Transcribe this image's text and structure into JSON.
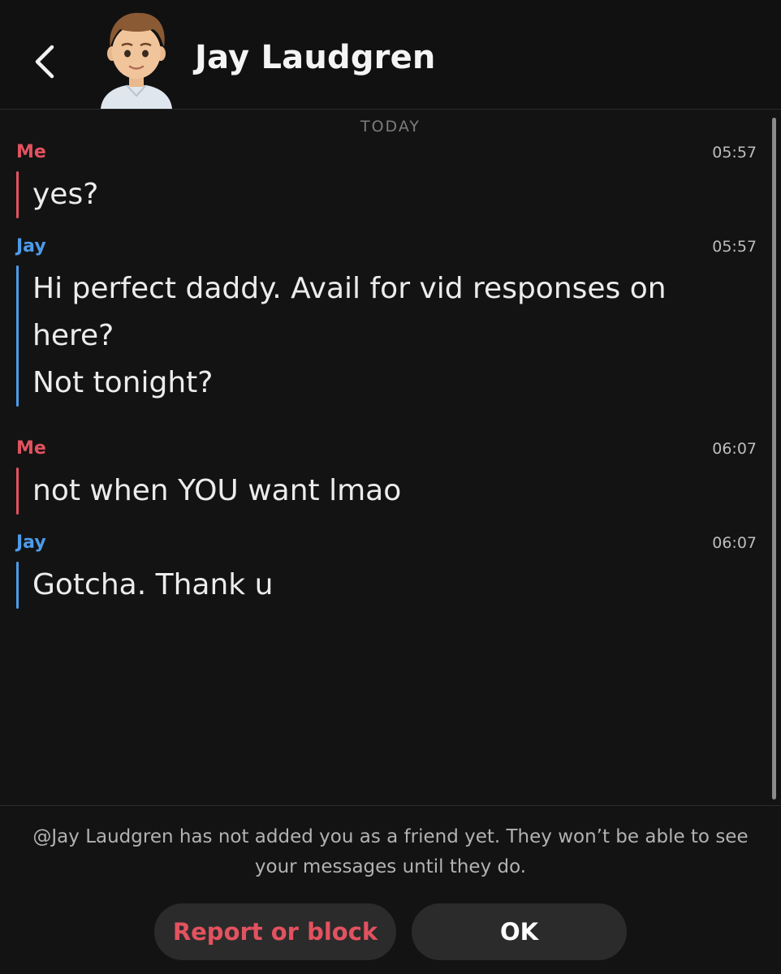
{
  "header": {
    "contact_name": "Jay Laudgren",
    "back_icon": "chevron-left-icon",
    "avatar_icon": "bitmoji-avatar"
  },
  "chat": {
    "day_separator": "TODAY",
    "messages": [
      {
        "sender": "Me",
        "time": "05:57",
        "lines": [
          "yes?"
        ]
      },
      {
        "sender": "Jay",
        "time": "05:57",
        "lines": [
          "Hi perfect daddy. Avail for vid responses on",
          "here?",
          "Not tonight?"
        ]
      },
      {
        "sender": "Me",
        "time": "06:07",
        "lines": [
          "not when YOU want lmao"
        ]
      },
      {
        "sender": "Jay",
        "time": "06:07",
        "lines": [
          "Gotcha. Thank u"
        ]
      }
    ]
  },
  "footer": {
    "notice": "@Jay Laudgren has not added you as a friend yet. They won’t be able to see your messages until they do.",
    "report_label": "Report or block",
    "ok_label": "OK"
  },
  "colors": {
    "me": "#e2525f",
    "jay": "#4d9be9",
    "background": "#131313"
  }
}
